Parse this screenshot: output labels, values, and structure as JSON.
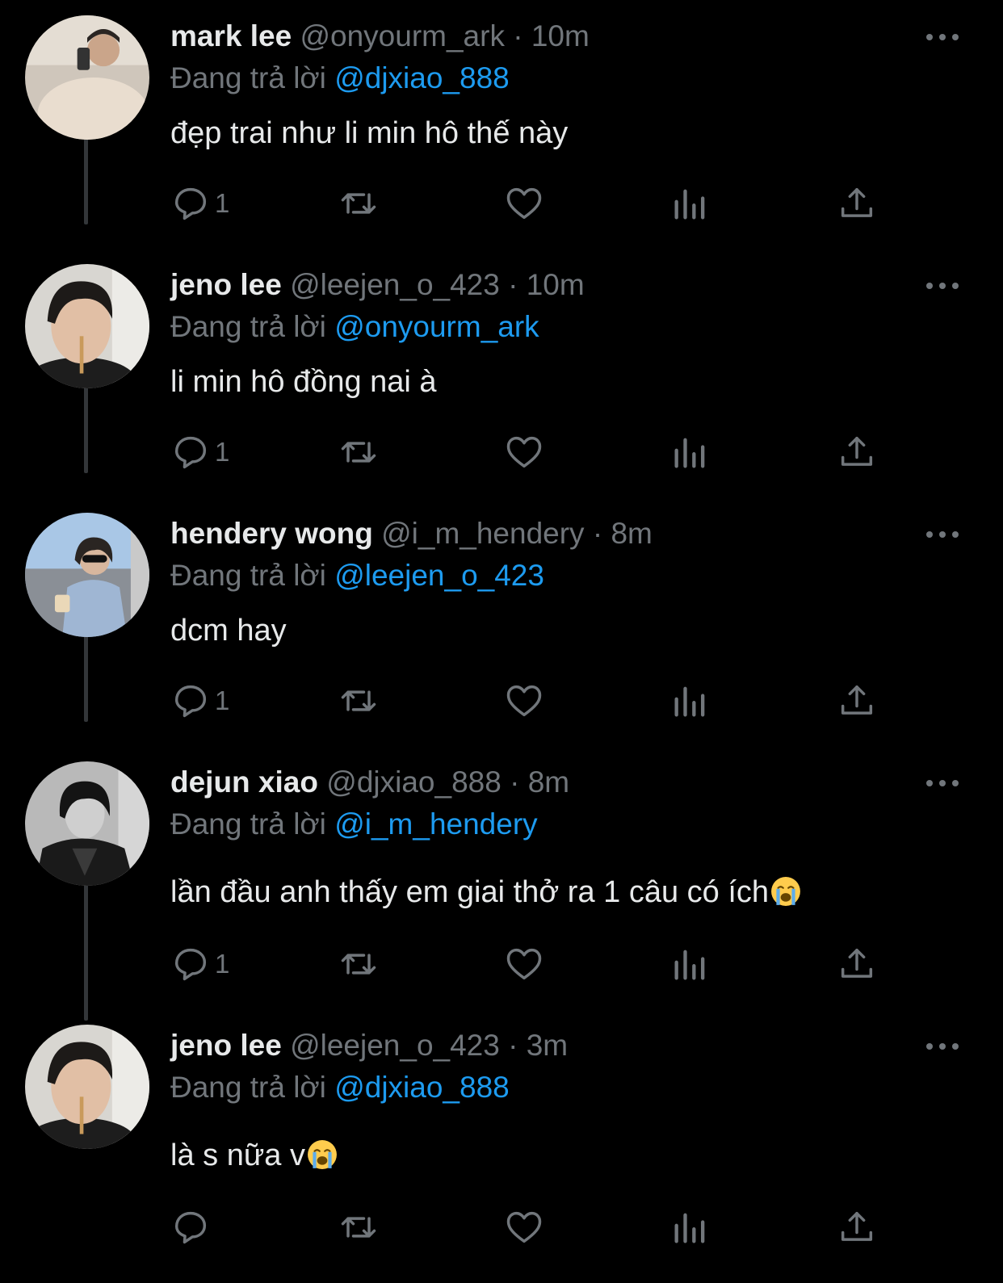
{
  "reply_prefix": "Đang trả lời",
  "theme": {
    "background": "#000000",
    "text": "#e7e9ea",
    "muted": "#71767b",
    "link": "#1d9bf0",
    "thread_line": "#333639"
  },
  "tweets": [
    {
      "name": "mark lee",
      "handle": "@onyourm_ark",
      "separator": "·",
      "time": "10m",
      "reply_to": "@djxiao_888",
      "text": "đẹp trai như li min hô thế này",
      "reply_count": "1",
      "emoji": ""
    },
    {
      "name": "jeno lee",
      "handle": "@leejen_o_423",
      "separator": "·",
      "time": "10m",
      "reply_to": "@onyourm_ark",
      "text": "li min hô đồng nai à",
      "reply_count": "1",
      "emoji": ""
    },
    {
      "name": "hendery wong",
      "handle": "@i_m_hendery",
      "separator": "·",
      "time": "8m",
      "reply_to": "@leejen_o_423",
      "text": "dcm hay",
      "reply_count": "1",
      "emoji": ""
    },
    {
      "name": "dejun xiao",
      "handle": "@djxiao_888",
      "separator": "·",
      "time": "8m",
      "reply_to": "@i_m_hendery",
      "text": "lần đầu anh thấy em giai thở ra 1 câu có ích",
      "reply_count": "1",
      "emoji": "loudly-crying-face"
    },
    {
      "name": "jeno lee",
      "handle": "@leejen_o_423",
      "separator": "·",
      "time": "3m",
      "reply_to": "@djxiao_888",
      "text": "là s nữa v",
      "reply_count": "",
      "emoji": "loudly-crying-face"
    }
  ],
  "icons": {
    "reply": "reply-icon",
    "retweet": "retweet-icon",
    "like": "heart-icon",
    "views": "views-icon",
    "share": "share-icon",
    "more": "more-icon"
  }
}
